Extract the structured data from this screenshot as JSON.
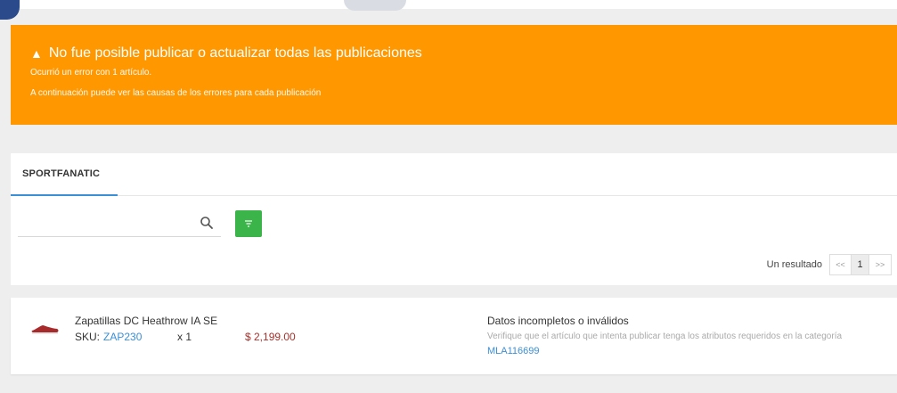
{
  "alert": {
    "title": "No fue posible publicar o actualizar todas las publicaciones",
    "line1": "Ocurrió un error con 1 artículo.",
    "line2": "A continuación puede ver las causas de los errores para cada publicación",
    "color": "#ff9800",
    "icon": "warning-icon"
  },
  "tabs": {
    "active": "SPORTFANATIC"
  },
  "search": {
    "value": "",
    "placeholder": "",
    "icon": "search-icon"
  },
  "filter": {
    "icon": "filter-icon",
    "color": "#3bb44a"
  },
  "pagination": {
    "result_text": "Un resultado",
    "first": "<<",
    "current": "1",
    "last": ">>"
  },
  "item": {
    "name": "Zapatillas DC Heathrow IA SE",
    "sku_label": "SKU:",
    "sku": "ZAP230",
    "qty": "x 1",
    "price": "$ 2,199.00",
    "error_title": "Datos incompletos o inválidos",
    "error_desc": "Verifique que el artículo que intenta publicar tenga los atributos requeridos en la categoría",
    "category": "MLA116699",
    "icon": "shoe-icon"
  }
}
